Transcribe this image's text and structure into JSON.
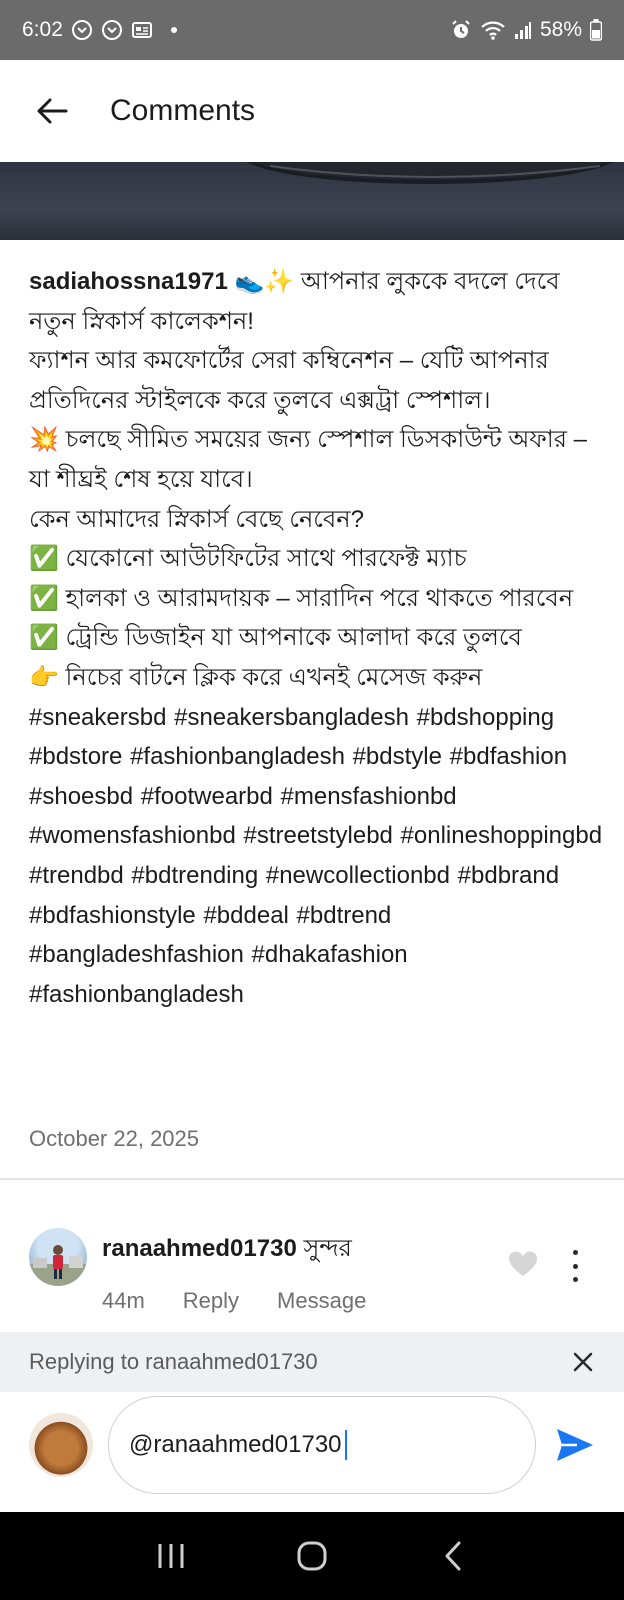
{
  "status_bar": {
    "time": "6:02",
    "battery": "58%"
  },
  "header": {
    "title": "Comments"
  },
  "post": {
    "username": "sadiahossna1971",
    "caption_lines": [
      "👟✨ আপনার লুককে বদলে দেবে নতুন স্নিকার্স কালেকশন!",
      "ফ্যাশন আর কমফোর্টের সেরা কম্বিনেশন – যেটি আপনার প্রতিদিনের স্টাইলকে করে তুলবে এক্সট্রা স্পেশাল।",
      "💥 চলছে সীমিত সময়ের জন্য স্পেশাল ডিসকাউন্ট অফার – যা শীঘ্রই শেষ হয়ে যাবে।",
      "কেন আমাদের স্নিকার্স বেছে নেবেন?",
      "✅ যেকোনো আউটফিটের সাথে পারফেক্ট ম্যাচ",
      "✅ হালকা ও আরামদায়ক – সারাদিন পরে থাকতে পারবেন",
      "✅ ট্রেন্ডি ডিজাইন যা আপনাকে আলাদা করে তুলবে",
      "👉 নিচের বাটনে ক্লিক করে এখনই মেসেজ করুন"
    ],
    "hashtags": "#sneakersbd #sneakersbangladesh #bdshopping #bdstore #fashionbangladesh #bdstyle #bdfashion #shoesbd #footwearbd #mensfashionbd #womensfashionbd #streetstylebd #onlineshoppingbd #trendbd #bdtrending #newcollectionbd #bdbrand #bdfashionstyle #bddeal #bdtrend #bangladeshfashion #dhakafashion #fashionbangladesh",
    "date": "October 22, 2025"
  },
  "comment": {
    "username": "ranaahmed01730",
    "text": "সুন্দর",
    "time": "44m",
    "reply_label": "Reply",
    "message_label": "Message"
  },
  "reply_bar": {
    "text": "Replying to ranaahmed01730"
  },
  "composer": {
    "value": "@ranaahmed01730"
  },
  "colors": {
    "accent": "#1877f2",
    "status_bar": "#6b6b6b",
    "reply_bar": "#eef1f4"
  }
}
